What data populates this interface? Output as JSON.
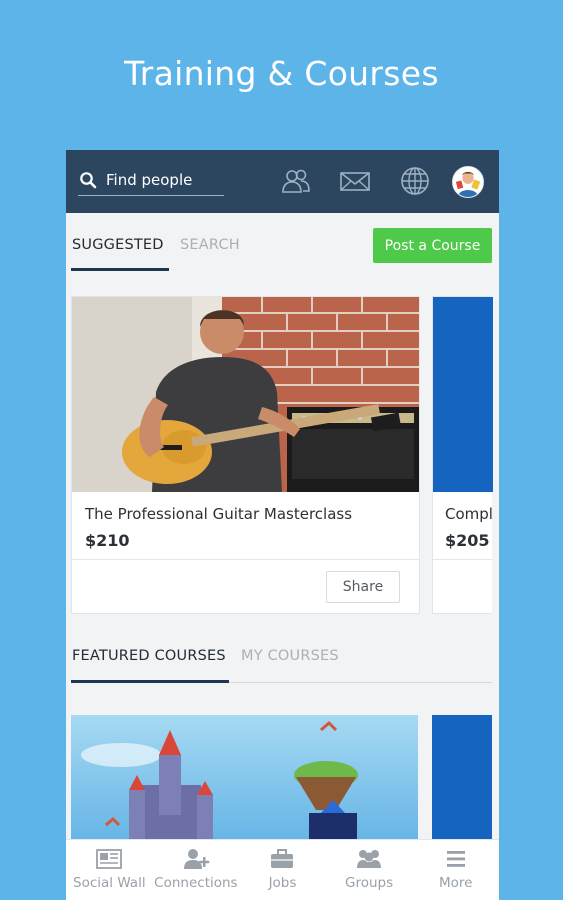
{
  "promo": {
    "title": "Training & Courses"
  },
  "topbar": {
    "search_placeholder": "Find people",
    "icons": [
      "search-icon",
      "people-icon",
      "mail-icon",
      "globe-icon",
      "avatar"
    ]
  },
  "tabs_top": [
    {
      "label": "SUGGESTED",
      "active": true
    },
    {
      "label": "SEARCH",
      "active": false
    }
  ],
  "post_course_label": "Post a Course",
  "courses": [
    {
      "title": "The Professional Guitar Masterclass",
      "price": "$210",
      "share_label": "Share"
    },
    {
      "title": "Compl",
      "price": "$205"
    }
  ],
  "tabs_featured": [
    {
      "label": "FEATURED COURSES",
      "active": true
    },
    {
      "label": "MY COURSES",
      "active": false
    }
  ],
  "bottom_nav": [
    {
      "label": "Social Wall",
      "icon": "newspaper-icon"
    },
    {
      "label": "Connections",
      "icon": "add-person-icon"
    },
    {
      "label": "Jobs",
      "icon": "briefcase-icon"
    },
    {
      "label": "Groups",
      "icon": "group-icon"
    },
    {
      "label": "More",
      "icon": "menu-icon"
    }
  ],
  "colors": {
    "background": "#5db4e8",
    "topbar": "#2d4660",
    "accent_green": "#4ec94a",
    "tab_underline": "#1e3650",
    "card_blue": "#1565c0"
  }
}
